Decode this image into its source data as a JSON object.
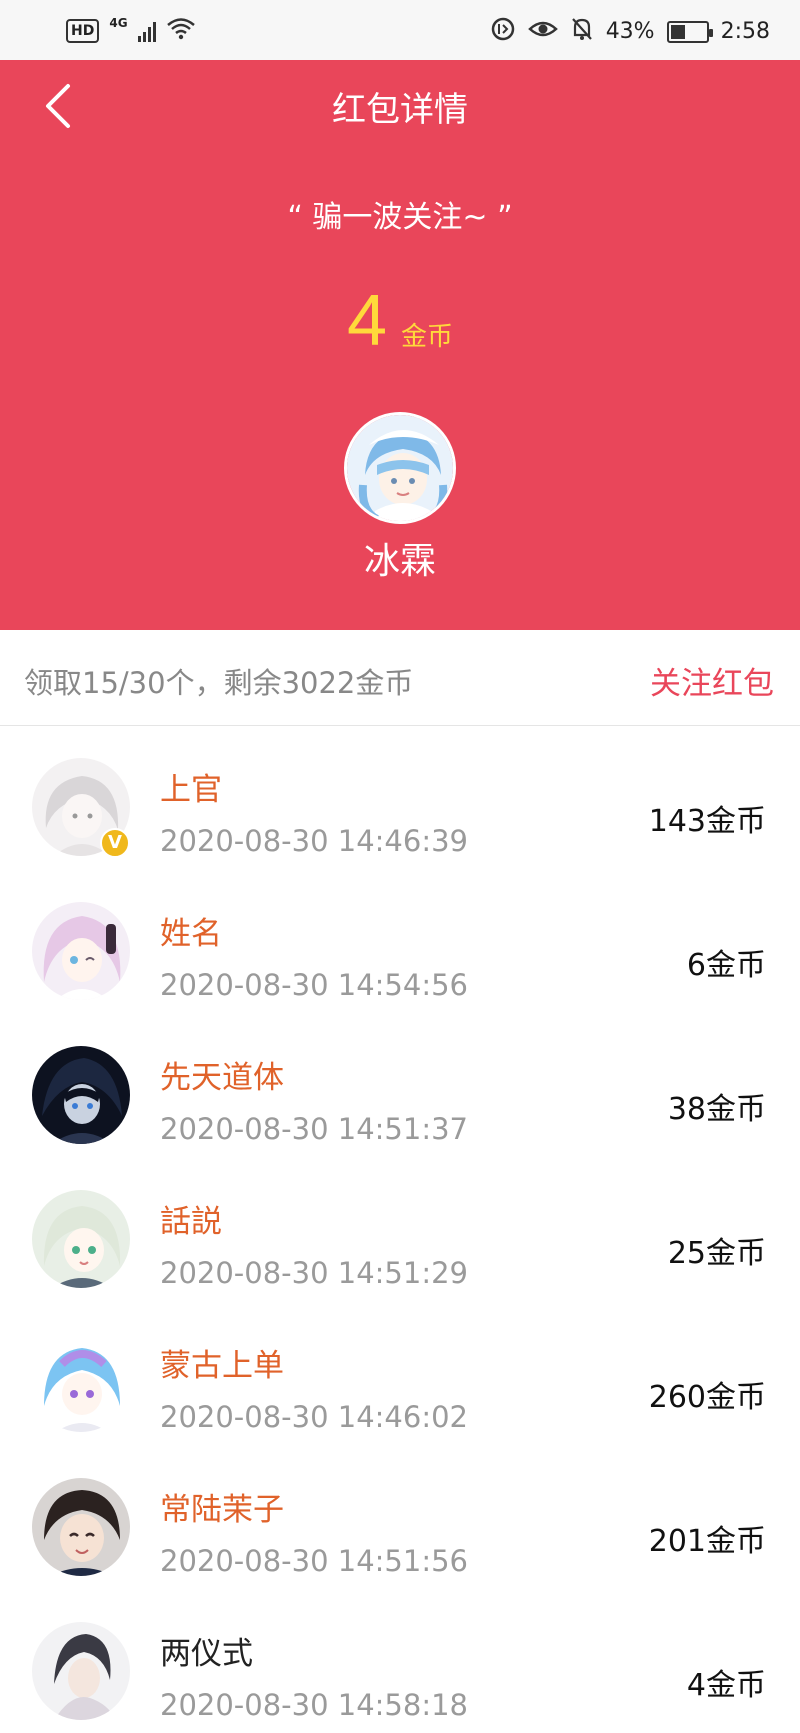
{
  "status_bar": {
    "hd": "HD",
    "network": "4G",
    "battery_percent": "43%",
    "battery_level": 0.43,
    "time": "2:58"
  },
  "header": {
    "title": "红包详情",
    "blessing": "“ 骗一波关注~ ”",
    "amount": "4",
    "amount_unit": "金币",
    "sender_name": "冰霖",
    "background_color": "#e9465a",
    "amount_color": "#ffd93b"
  },
  "summary": {
    "text": "领取15/30个，剩余3022金币",
    "link": "关注红包"
  },
  "records": [
    {
      "name": "上官",
      "time": "2020-08-30 14:46:39",
      "amount": "143金币",
      "verified": true,
      "verified_mark": "V",
      "name_colored": true
    },
    {
      "name": "姓名",
      "time": "2020-08-30 14:54:56",
      "amount": "6金币",
      "verified": false,
      "name_colored": true
    },
    {
      "name": "先天道体",
      "time": "2020-08-30 14:51:37",
      "amount": "38金币",
      "verified": false,
      "name_colored": true
    },
    {
      "name": "話説",
      "time": "2020-08-30 14:51:29",
      "amount": "25金币",
      "verified": false,
      "name_colored": true
    },
    {
      "name": "蒙古上单",
      "time": "2020-08-30 14:46:02",
      "amount": "260金币",
      "verified": false,
      "name_colored": true
    },
    {
      "name": "常陆茉子",
      "time": "2020-08-30 14:51:56",
      "amount": "201金币",
      "verified": false,
      "name_colored": true
    },
    {
      "name": "两仪式",
      "time": "2020-08-30 14:58:18",
      "amount": "4金币",
      "verified": false,
      "name_colored": false
    }
  ]
}
